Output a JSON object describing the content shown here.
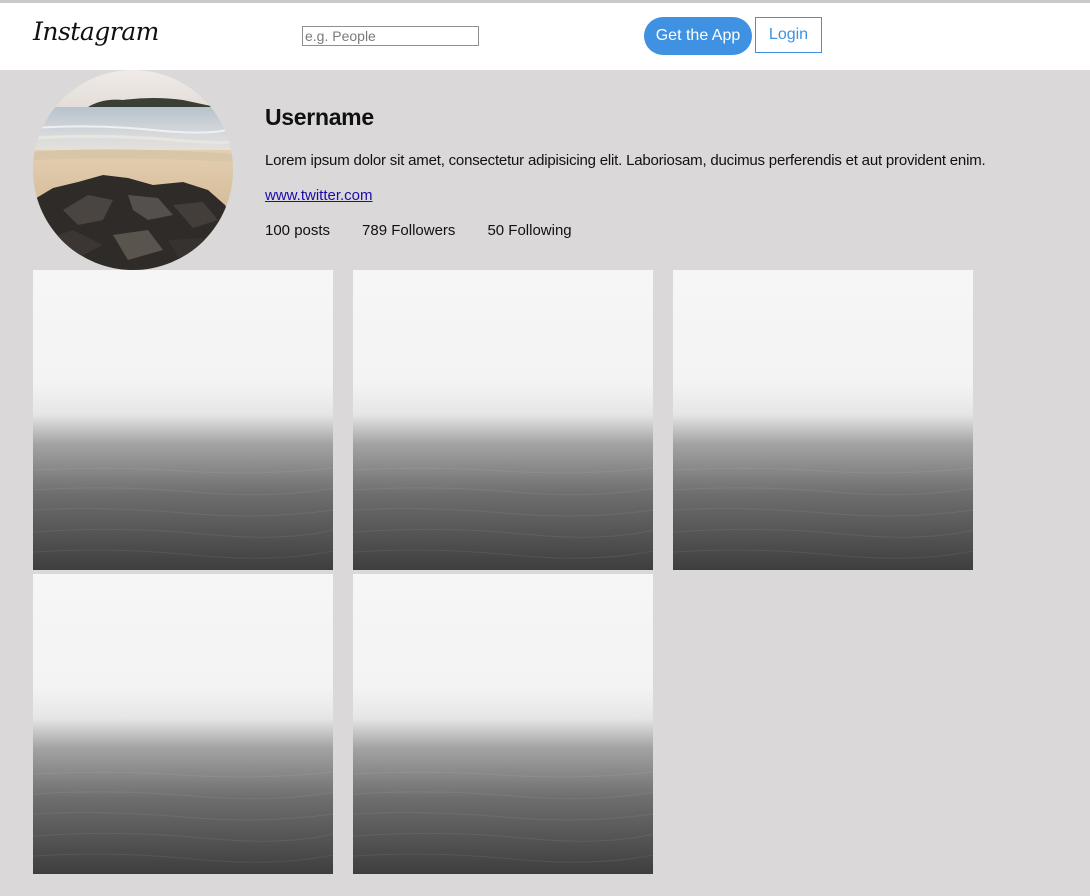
{
  "header": {
    "logo": "Instagram",
    "search_placeholder": "e.g. People",
    "get_app_label": "Get the App",
    "login_label": "Login"
  },
  "profile": {
    "username": "Username",
    "bio": "Lorem ipsum dolor sit amet, consectetur adipisicing elit. Laboriosam, ducimus perferendis et aut provident enim.",
    "link": "www.twitter.com",
    "stats": {
      "posts": "100 posts",
      "followers": "789 Followers",
      "following": "50 Following"
    }
  },
  "gallery": {
    "photo_count": 5
  },
  "colors": {
    "accent": "#3e92e1",
    "page_background": "#dad8d9",
    "header_background": "#ffffff"
  }
}
